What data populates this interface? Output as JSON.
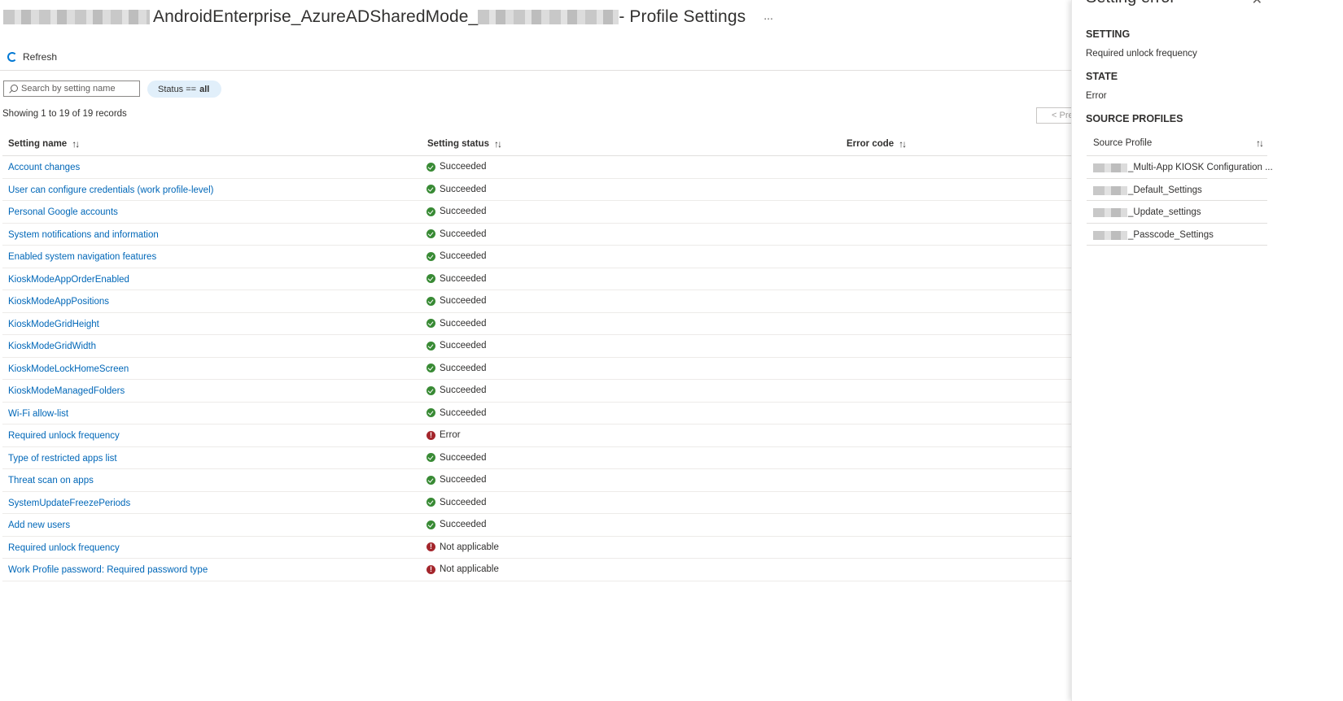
{
  "header": {
    "title_main": "AndroidEnterprise_AzureADSharedMode_",
    "title_suffix": " - Profile Settings",
    "more_icon": "..."
  },
  "toolbar": {
    "refresh_label": "Refresh",
    "refresh_icon": "refresh-icon"
  },
  "filters": {
    "search_placeholder": "Search by setting name",
    "status_filter_label": "Status ==",
    "status_filter_value": "all"
  },
  "records_text": "Showing 1 to 19 of 19 records",
  "pagination": {
    "prev_label": "< Pre"
  },
  "table": {
    "columns": [
      "Setting name",
      "Setting status",
      "Error code"
    ],
    "rows": [
      {
        "name": "Account changes",
        "status": "Succeeded",
        "kind": "ok"
      },
      {
        "name": "User can configure credentials (work profile-level)",
        "status": "Succeeded",
        "kind": "ok"
      },
      {
        "name": "Personal Google accounts",
        "status": "Succeeded",
        "kind": "ok"
      },
      {
        "name": "System notifications and information",
        "status": "Succeeded",
        "kind": "ok"
      },
      {
        "name": "Enabled system navigation features",
        "status": "Succeeded",
        "kind": "ok"
      },
      {
        "name": "KioskModeAppOrderEnabled",
        "status": "Succeeded",
        "kind": "ok"
      },
      {
        "name": "KioskModeAppPositions",
        "status": "Succeeded",
        "kind": "ok"
      },
      {
        "name": "KioskModeGridHeight",
        "status": "Succeeded",
        "kind": "ok"
      },
      {
        "name": "KioskModeGridWidth",
        "status": "Succeeded",
        "kind": "ok"
      },
      {
        "name": "KioskModeLockHomeScreen",
        "status": "Succeeded",
        "kind": "ok"
      },
      {
        "name": "KioskModeManagedFolders",
        "status": "Succeeded",
        "kind": "ok"
      },
      {
        "name": "Wi-Fi allow-list",
        "status": "Succeeded",
        "kind": "ok"
      },
      {
        "name": "Required unlock frequency",
        "status": "Error",
        "kind": "err"
      },
      {
        "name": "Type of restricted apps list",
        "status": "Succeeded",
        "kind": "ok"
      },
      {
        "name": "Threat scan on apps",
        "status": "Succeeded",
        "kind": "ok"
      },
      {
        "name": "SystemUpdateFreezePeriods",
        "status": "Succeeded",
        "kind": "ok"
      },
      {
        "name": "Add new users",
        "status": "Succeeded",
        "kind": "ok"
      },
      {
        "name": "Required unlock frequency",
        "status": "Not applicable",
        "kind": "err"
      },
      {
        "name": "Work Profile password: Required password type",
        "status": "Not applicable",
        "kind": "err"
      }
    ]
  },
  "panel": {
    "title": "Setting error",
    "setting_label": "SETTING",
    "setting_value": "Required unlock frequency",
    "state_label": "STATE",
    "state_value": "Error",
    "source_label": "SOURCE PROFILES",
    "source_column": "Source Profile",
    "source_profiles": [
      "_Multi-App KIOSK Configuration ...",
      "_Default_Settings",
      "_Update_settings",
      "_Passcode_Settings"
    ]
  },
  "colors": {
    "link": "#0067b8",
    "success": "#388a34",
    "error": "#a4262c",
    "accent": "#0078d4",
    "pill_bg": "#e1effa"
  }
}
